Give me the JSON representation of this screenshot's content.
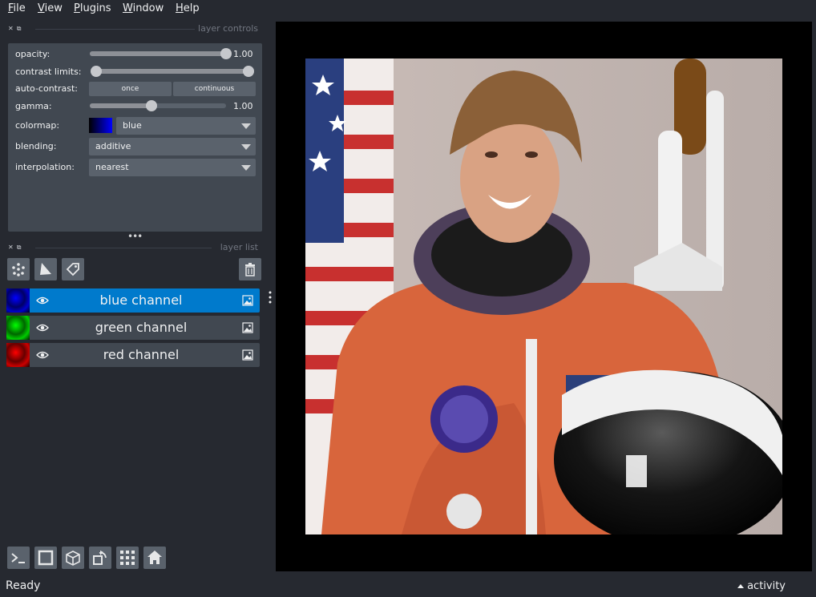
{
  "menu": {
    "items": [
      {
        "first": "F",
        "rest": "ile"
      },
      {
        "first": "V",
        "rest": "iew"
      },
      {
        "first": "P",
        "rest": "lugins"
      },
      {
        "first": "W",
        "rest": "indow"
      },
      {
        "first": "H",
        "rest": "elp"
      }
    ]
  },
  "layer_controls": {
    "title": "layer controls",
    "opacity_label": "opacity:",
    "opacity_value": "1.00",
    "opacity": 1.0,
    "contrast_label": "contrast limits:",
    "contrast_range": [
      0.0,
      1.0
    ],
    "auto_contrast_label": "auto-contrast:",
    "once_label": "once",
    "continuous_label": "continuous",
    "gamma_label": "gamma:",
    "gamma_value": "1.00",
    "gamma": 0.45,
    "colormap_label": "colormap:",
    "colormap_value": "blue",
    "blending_label": "blending:",
    "blending_value": "additive",
    "interpolation_label": "interpolation:",
    "interpolation_value": "nearest"
  },
  "layer_list": {
    "title": "layer list",
    "layers": [
      {
        "name": "blue channel",
        "selected": true,
        "color": "#0000ff"
      },
      {
        "name": "green channel",
        "selected": false,
        "color": "#00ff00"
      },
      {
        "name": "red channel",
        "selected": false,
        "color": "#ff0000"
      }
    ]
  },
  "colors": {
    "background": "#262930",
    "panel": "#414851",
    "control": "#5a626c",
    "selected": "#007acc"
  },
  "status": {
    "text": "Ready",
    "activity_label": "activity"
  }
}
